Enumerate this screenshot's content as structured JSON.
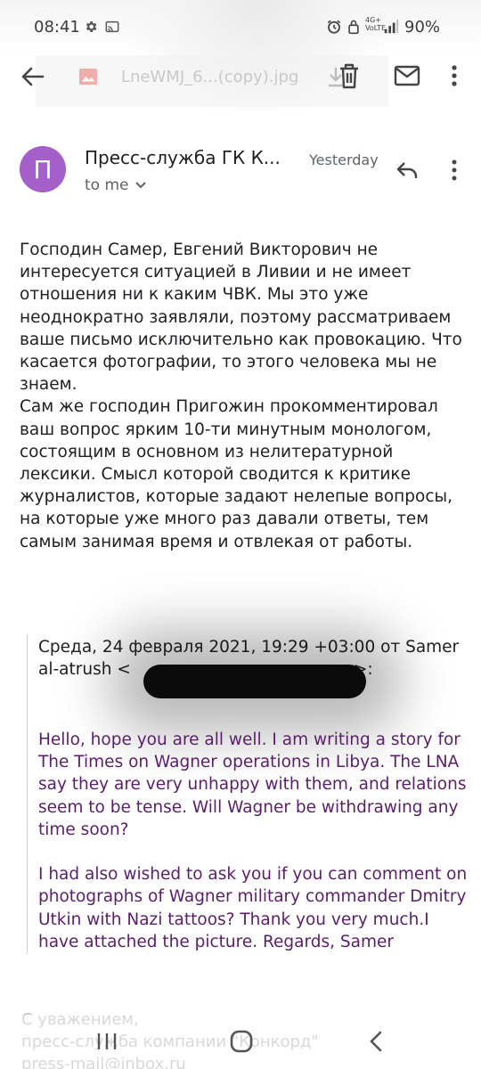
{
  "status_bar": {
    "time": "08:41",
    "network": [
      "4G+",
      "VoLTE"
    ],
    "battery": "90%",
    "icons": [
      "gear-icon",
      "cast-icon",
      "alarm-icon",
      "lock-icon",
      "signal-icon"
    ]
  },
  "attachment_bar": {
    "filename": "LneWMJ_6...(copy).jpg"
  },
  "header": {
    "avatar_letter": "П",
    "avatar_color": "#a45fc9",
    "sender": "Пресс-служба ГК К...",
    "date": "Yesterday",
    "recipient": "to me"
  },
  "body": "Господин Самер, Евгений Викторович не интересуется ситуацией в Ливии и не имеет отношения ни к каким ЧВК. Мы это уже неоднократно заявляли, поэтому рассматриваем ваше письмо исключительно как провокацию. Что касается фотографии, то этого человека мы не знаем.\nСам же господин Пригожин прокомментировал ваш вопрос ярким 10-ти минутным монологом, состоящим в основном из нелитературной лексики. Смысл которой сводится к критике журналистов, которые задают нелепые вопросы, на которые уже много раз давали ответы, тем самым занимая время и отвлекая от работы.",
  "quote": {
    "header": "Среда, 24 февраля 2021, 19:29 +03:00 от Samer al-atrush <",
    "header_end": ">:",
    "text": "Hello, hope you are all well. I am writing a story for The Times on Wagner operations in Libya. The LNA say they are very unhappy with them, and relations seem to be tense. Will Wagner  be withdrawing any time soon?\n\nI had also wished to ask you if you can comment on photographs of Wagner military commander Dmitry Utkin with Nazi tattoos? Thank you very much.I have attached the picture. Regards, Samer",
    "text_color": "#5b1e6d"
  },
  "signature": "С уважением,\nпресс-служба компании \"Конкорд\"\npress-mail@inbox.ru"
}
